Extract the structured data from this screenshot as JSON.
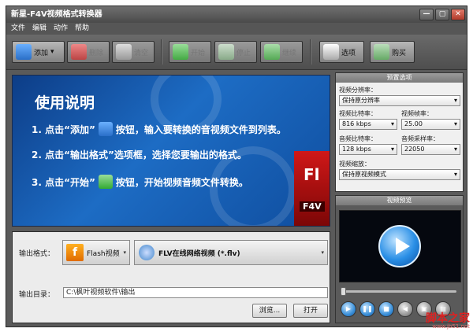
{
  "window": {
    "title": "新星-F4V视频格式转换器",
    "min": "—",
    "max": "▢",
    "close": "✕"
  },
  "menu": [
    {
      "label": "文件"
    },
    {
      "label": "编辑"
    },
    {
      "label": "动作"
    },
    {
      "label": "帮助"
    }
  ],
  "toolbar": {
    "add": "添加",
    "add_arrow": "▾",
    "delete": "删除",
    "clear": "清空",
    "start": "开始",
    "stop": "停止",
    "resume": "继续",
    "options": "选项",
    "buy": "购买"
  },
  "banner": {
    "title": "使用说明",
    "line1_a": "1. 点击“添加”",
    "line1_b": "按钮，输入要转换的音视频文件到列表。",
    "line2": "2. 点击“输出格式”选项框，选择您要输出的格式。",
    "line3_a": "3. 点击“开始”",
    "line3_b": "按钮，开始视频音频文件转换。",
    "flv_big": "Fl",
    "flv_small": "F4V"
  },
  "output": {
    "format_label": "输出格式：",
    "format_value": "Flash视频",
    "format_icon_text": "f",
    "sub_value": "FLV在线网络视频 (*.flv)",
    "dir_label": "输出目录：",
    "dir_value": "C:\\枫叶视频软件\\输出",
    "browse": "浏览...",
    "open": "打开",
    "arrow": "▾"
  },
  "settings": {
    "header": "预置选项",
    "resolution_label": "视频分辨率：",
    "resolution_value": "保持原分辨率",
    "vbitrate_label": "视频比特率：",
    "vbitrate_value": "816 kbps",
    "framerate_label": "视频帧率：",
    "framerate_value": "25.00",
    "abitrate_label": "音频比特率：",
    "abitrate_value": "128 kbps",
    "samplerate_label": "音频采样率：",
    "samplerate_value": "22050",
    "scale_label": "视频缩放：",
    "scale_value": "保持原视频模式"
  },
  "preview": {
    "header": "视频预览"
  },
  "watermark": {
    "text": "脚本之家",
    "url": "www.jb51.net"
  }
}
